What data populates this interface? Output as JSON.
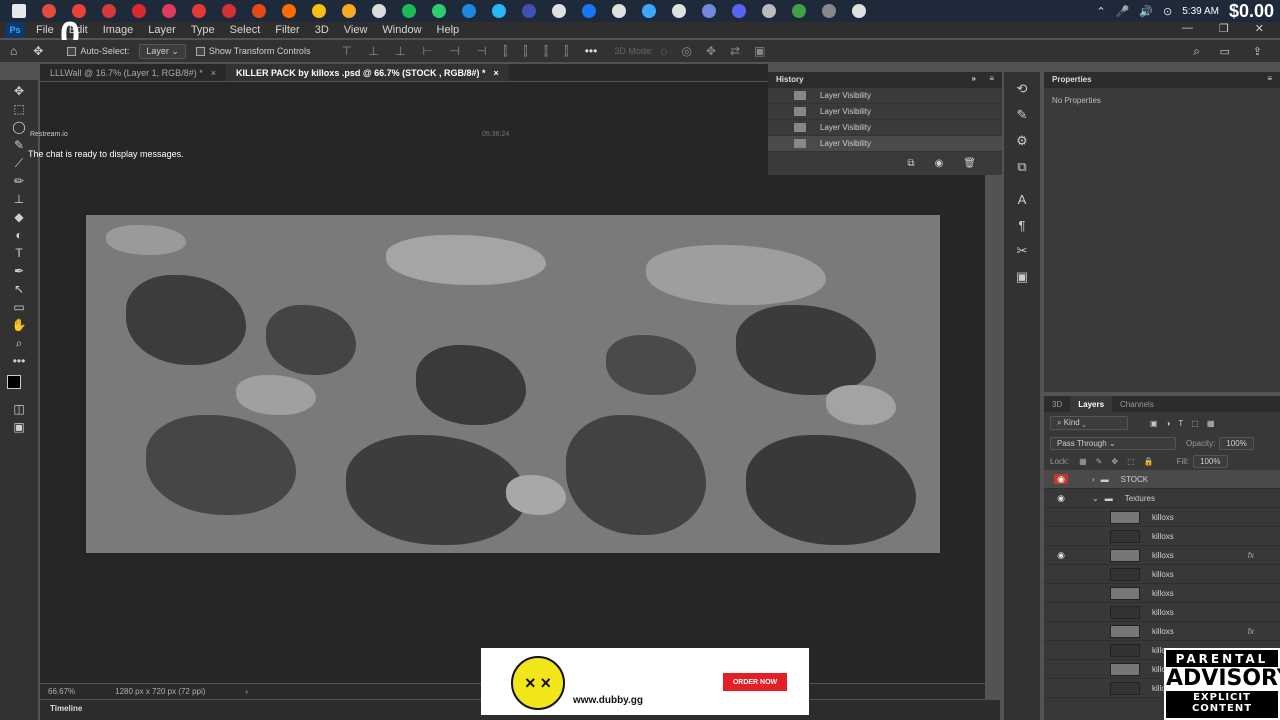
{
  "taskbar": {
    "icon_colors": [
      "#e8e8e8",
      "#e34b3c",
      "#ea4335",
      "#d63a3a",
      "#d92b2b",
      "#e03a5c",
      "#e53935",
      "#d63031",
      "#e64a19",
      "#ff6d00",
      "#f4c20d",
      "#f9a825",
      "#dcdcdc",
      "#1db954",
      "#2ecc71",
      "#1e88e5",
      "#29b6f6",
      "#3f51b5",
      "#e0e0e0",
      "#1877f2",
      "#e0e0e0",
      "#3ea6ff",
      "#e0e0e0",
      "#7289da",
      "#5865f2",
      "#bbbbbb",
      "#43a047",
      "#888888",
      "#e0e0e0"
    ],
    "clock": "5:39 AM",
    "balance": "$0.00"
  },
  "menubar": {
    "items": [
      "File",
      "Edit",
      "Image",
      "Layer",
      "Type",
      "Select",
      "Filter",
      "3D",
      "View",
      "Window",
      "Help"
    ],
    "ps_logo": "Ps",
    "overlay_counter": "0"
  },
  "options": {
    "auto_select_label": "Auto-Select:",
    "auto_select_value": "Layer",
    "show_transform_label": "Show Transform Controls",
    "mode_3d_label": "3D Mode:"
  },
  "tabs": [
    {
      "label": "LLLWall @ 16.7% (Layer 1, RGB/8#) *",
      "active": false
    },
    {
      "label": "KILLER PACK  by killoxs .psd @ 66.7% (STOCK , RGB/8#) *",
      "active": true
    }
  ],
  "overlay": {
    "stream_label": "Restream.io",
    "chat_message": "The chat is ready to display messages.",
    "timer": "05:36:24"
  },
  "status": {
    "zoom": "66.67%",
    "doc_info": "1280 px x 720 px (72 ppi)"
  },
  "timeline": {
    "label": "Timeline"
  },
  "history": {
    "title": "History",
    "items": [
      {
        "label": "Layer Visibility",
        "selected": false
      },
      {
        "label": "Layer Visibility",
        "selected": false
      },
      {
        "label": "Layer Visibility",
        "selected": false
      },
      {
        "label": "Layer Visibility",
        "selected": true
      }
    ]
  },
  "properties": {
    "title": "Properties",
    "empty_text": "No Properties"
  },
  "layers": {
    "tabs": [
      "3D",
      "Layers",
      "Channels"
    ],
    "active_tab": "Layers",
    "filter_kind": "Kind",
    "blend_mode": "Pass Through",
    "opacity_label": "Opacity:",
    "opacity_value": "100%",
    "lock_label": "Lock:",
    "fill_label": "Fill:",
    "fill_value": "100%",
    "rows": [
      {
        "name": "STOCK",
        "type": "group",
        "visible": true,
        "selected": true
      },
      {
        "name": "Textures",
        "type": "group",
        "visible": true,
        "selected": false
      },
      {
        "name": "killoxs",
        "type": "layer",
        "visible": false,
        "fx": false
      },
      {
        "name": "killoxs",
        "type": "layer",
        "visible": false,
        "fx": false
      },
      {
        "name": "killoxs",
        "type": "layer",
        "visible": true,
        "fx": true
      },
      {
        "name": "killoxs",
        "type": "layer",
        "visible": false,
        "fx": false
      },
      {
        "name": "killoxs",
        "type": "layer",
        "visible": false,
        "fx": false
      },
      {
        "name": "killoxs",
        "type": "layer",
        "visible": false,
        "fx": false
      },
      {
        "name": "killoxs",
        "type": "layer",
        "visible": false,
        "fx": true
      },
      {
        "name": "killoxs",
        "type": "layer",
        "visible": false,
        "fx": false
      },
      {
        "name": "killoxs",
        "type": "layer",
        "visible": false,
        "fx": false
      },
      {
        "name": "killoxs",
        "type": "layer",
        "visible": false,
        "fx": false
      }
    ],
    "fx_label": "fx"
  },
  "ad": {
    "url": "www.dubby.gg",
    "button": "ORDER NOW",
    "mascot_face": "× ×"
  },
  "advisory": {
    "line1": "PARENTAL",
    "line2": "ADVISORY",
    "line3": "EXPLICIT CONTENT"
  }
}
